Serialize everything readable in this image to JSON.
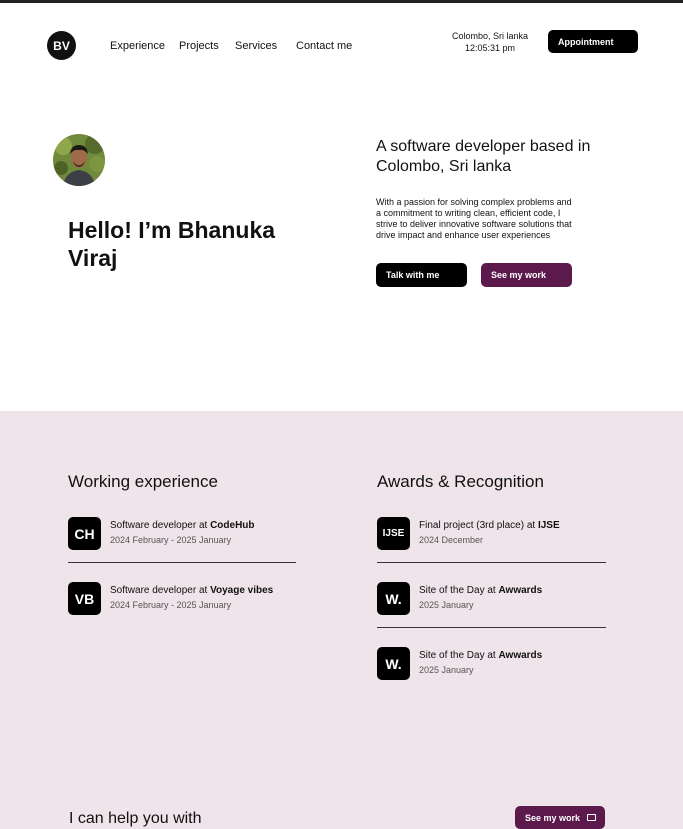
{
  "brand": {
    "logo_text": "BV"
  },
  "nav": {
    "items": [
      {
        "label": "Experience"
      },
      {
        "label": "Projects"
      },
      {
        "label": "Services"
      },
      {
        "label": "Contact me"
      }
    ]
  },
  "clock": {
    "location": "Colombo, Sri lanka",
    "time": "12:05:31 pm"
  },
  "header": {
    "appointment_label": "Appointment"
  },
  "hero": {
    "greeting": "Hello! I’m Bhanuka Viraj",
    "subtitle": "A software developer based in Colombo, Sri lanka",
    "description": "With a passion for solving complex problems and a commitment to writing clean, efficient code, I strive to deliver innovative software solutions that drive impact and enhance user experiences",
    "talk_label": "Talk with me",
    "work_label": "See my work"
  },
  "experience": {
    "title": "Working experience",
    "items": [
      {
        "badge": "CH",
        "role": "Software developer at ",
        "company": "CodeHub",
        "dates": "2024 February - 2025 January"
      },
      {
        "badge": "VB",
        "role": "Software developer at ",
        "company": "Voyage vibes",
        "dates": "2024 February - 2025 January"
      }
    ]
  },
  "awards": {
    "title": "Awards & Recognition",
    "items": [
      {
        "badge": "IJSE",
        "title": "Final project (3rd place) at ",
        "org": "IJSE",
        "date": "2024 December"
      },
      {
        "badge": "W.",
        "title": "Site of the Day at ",
        "org": "Awwards",
        "date": "2025 January"
      },
      {
        "badge": "W.",
        "title": "Site of the Day at ",
        "org": "Awwards",
        "date": "2025 January"
      }
    ]
  },
  "services": {
    "title": "I can help you with",
    "work_label": "See my work"
  },
  "colors": {
    "accent": "#5c1a4c",
    "section_bg": "#efe4ea",
    "dark": "#000000"
  }
}
